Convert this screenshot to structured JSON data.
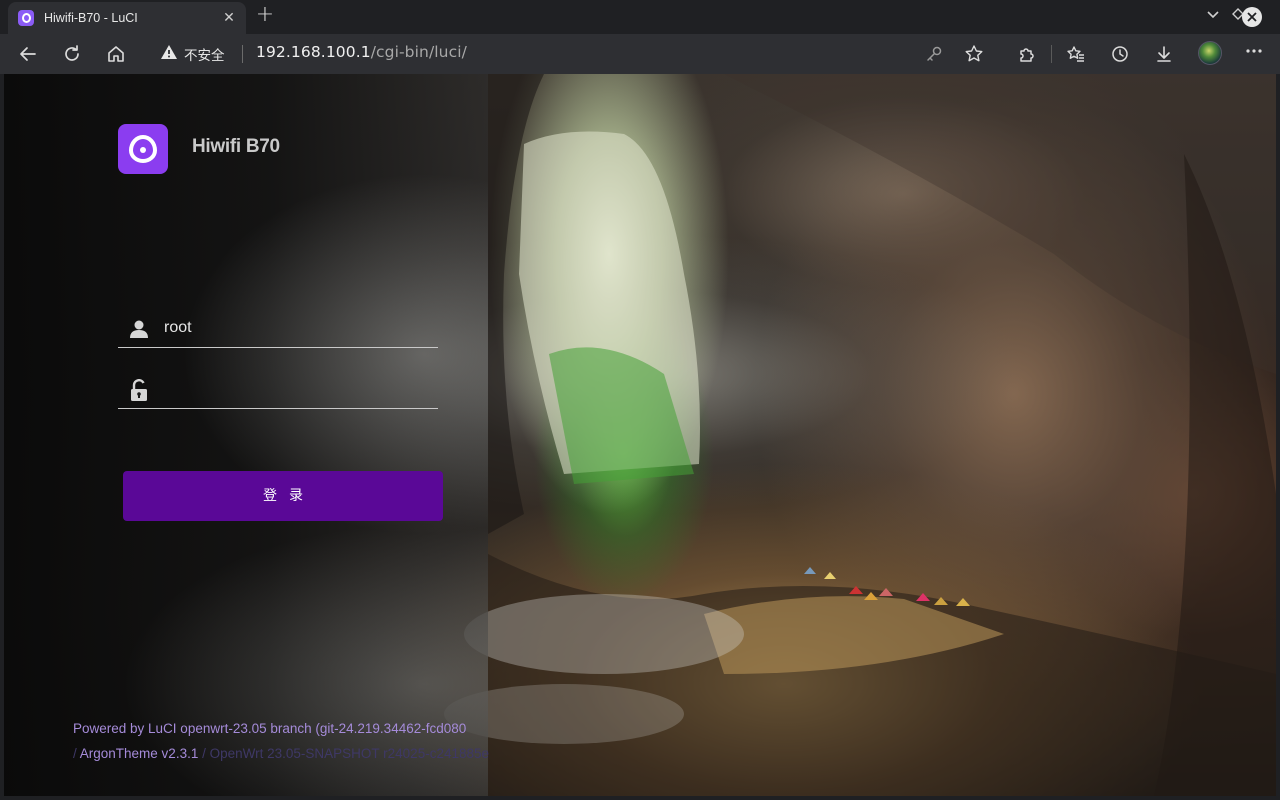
{
  "browser": {
    "tab_title": "Hiwifi-B70 - LuCI",
    "tab_close": "✕",
    "new_tab": "+",
    "security_label": "不安全",
    "url_host": "192.168.100.1",
    "url_path": "/cgi-bin/luci/"
  },
  "login": {
    "brand": "Hiwifi B70",
    "username_value": "root",
    "password_value": "",
    "submit_label": "登录"
  },
  "footer": {
    "line1": "Powered by LuCI openwrt-23.05 branch (git-24.219.34462-fcd080",
    "line2_sep": "/ ",
    "theme": "ArgonTheme v2.3.1",
    "line2_rest": " / OpenWrt 23.05-SNAPSHOT r24025-c241885e"
  },
  "colors": {
    "accent": "#5a0897",
    "logo": "#8b3df0",
    "footer_link": "#a58bd9"
  }
}
